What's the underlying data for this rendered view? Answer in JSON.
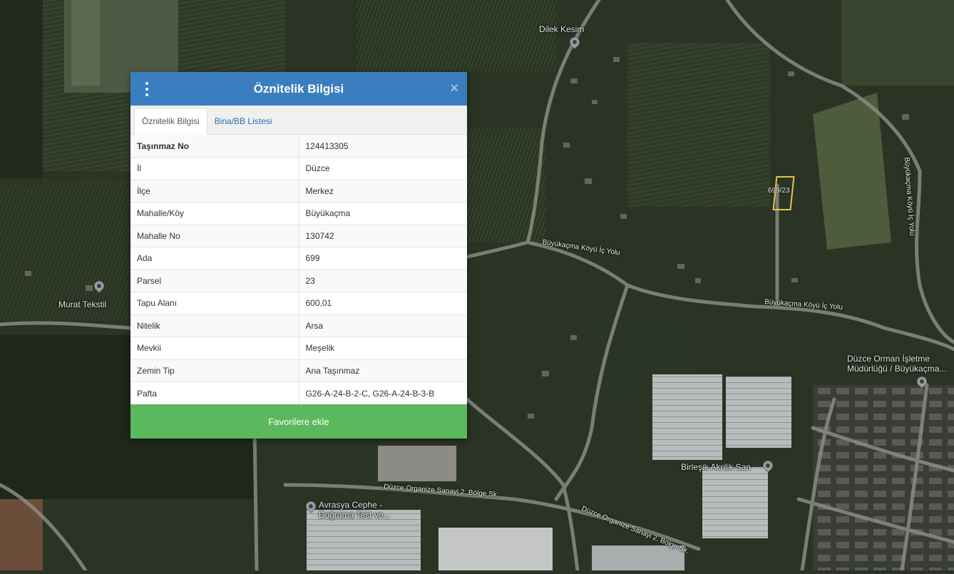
{
  "dialog": {
    "title": "Öznitelik Bilgisi",
    "menu_icon": "kebab-menu-icon",
    "close_label": "×",
    "tabs": [
      {
        "label": "Öznitelik Bilgisi",
        "active": true
      },
      {
        "label": "Bina/BB Listesi",
        "active": false
      }
    ],
    "rows": [
      {
        "key": "Taşınmaz No",
        "value": "124413305"
      },
      {
        "key": "İl",
        "value": "Düzce"
      },
      {
        "key": "İlçe",
        "value": "Merkez"
      },
      {
        "key": "Mahalle/Köy",
        "value": "Büyükaçma"
      },
      {
        "key": "Mahalle No",
        "value": "130742"
      },
      {
        "key": "Ada",
        "value": "699"
      },
      {
        "key": "Parsel",
        "value": "23"
      },
      {
        "key": "Tapu Alanı",
        "value": "600,01"
      },
      {
        "key": "Nitelik",
        "value": "Arsa"
      },
      {
        "key": "Mevkii",
        "value": "Meşelik"
      },
      {
        "key": "Zemin Tip",
        "value": "Ana Taşınmaz"
      },
      {
        "key": "Pafta",
        "value": "G26-A-24-B-2-C, G26-A-24-B-3-B"
      }
    ],
    "favorite_button": "Favorilere ekle"
  },
  "map": {
    "parcel_label": "699/23",
    "places": {
      "dilek_kesim": "Dilek Kesim",
      "murat_tekstil": "Murat Tekstil",
      "duzce_orman_1": "Düzce Orman İşletme",
      "duzce_orman_2": "Müdürlüğü / Büyükaçma...",
      "birlesik_akrilik": "Birleşik Akrilik San",
      "avrasya_1": "Avrasya Cephe -",
      "avrasya_2": "Doğrama Test ve..."
    },
    "roads": {
      "buyukacma_1": "Büyükaçma Köyü İç Yolu",
      "buyukacma_2": "Büyükaçma Köyü İç Yolu",
      "buyukacma_vertical": "Büyükaçma Köyü İç Yolu",
      "osb_1": "Düzce Organize Sanayi 2. Bölge Sk.",
      "osb_2": "Düzce Organize Sanayi 2. Bölge Sk."
    },
    "colors": {
      "header": "#3a7ec0",
      "button": "#5cb85c",
      "parcel": "#e2c64a"
    }
  }
}
